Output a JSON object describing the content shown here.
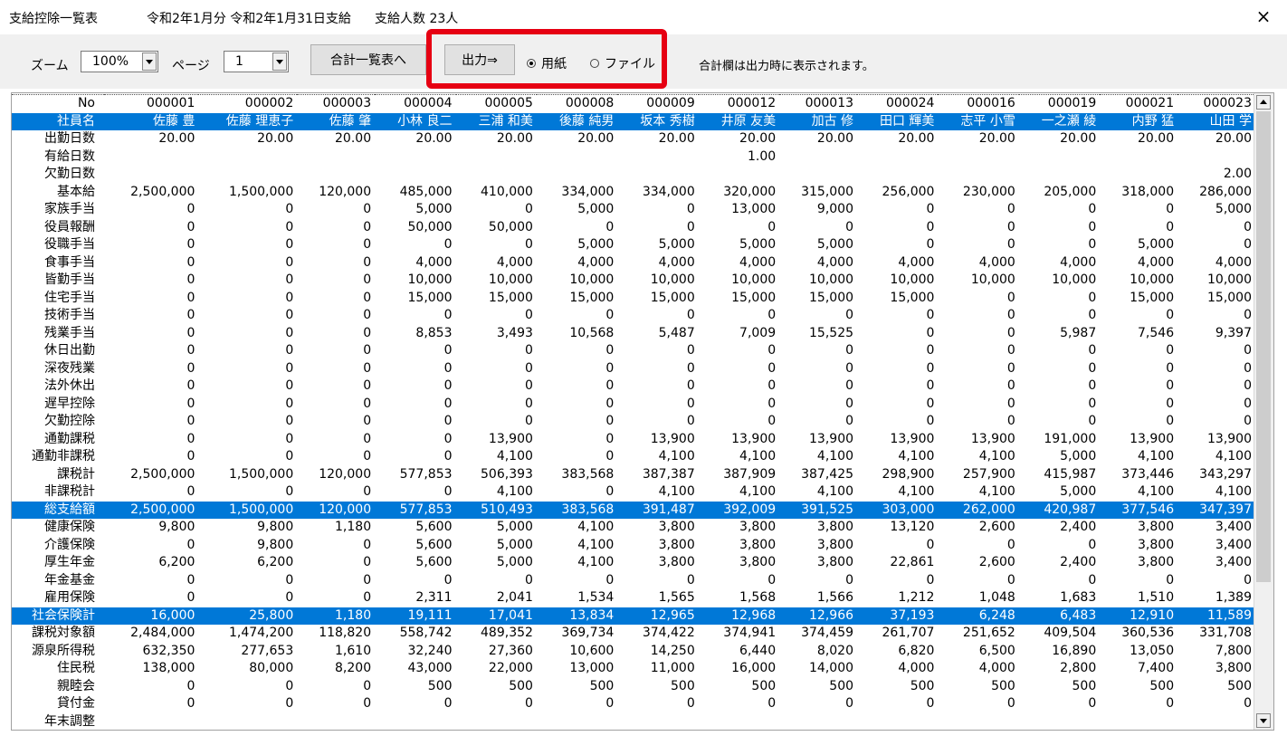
{
  "window": {
    "title": "支給控除一覧表",
    "period": "令和2年1月分 令和2年1月31日支給",
    "headcount": "支給人数 23人",
    "close_glyph": "×"
  },
  "toolbar": {
    "zoom_label": "ズーム",
    "zoom_value": "100%",
    "page_label": "ページ",
    "page_value": "1",
    "summary_button": "合計一覧表へ",
    "output_button": "出力⇒",
    "radio_paper": "用紙",
    "radio_file": "ファイル",
    "radio_selected": "paper",
    "note": "合計欄は出力時に表示されます。"
  },
  "colors": {
    "highlight": "#0078d7",
    "annotation": "#e60012"
  },
  "table": {
    "rows": [
      {
        "label": "No",
        "values": [
          "000001",
          "000002",
          "000003",
          "000004",
          "000005",
          "000008",
          "000009",
          "000012",
          "000013",
          "000024",
          "000016",
          "000019",
          "000021",
          "000023"
        ]
      },
      {
        "label": "社員名",
        "highlight": true,
        "values": [
          "佐藤 豊",
          "佐藤 理恵子",
          "佐藤 肇",
          "小林 良二",
          "三浦 和美",
          "後藤 純男",
          "坂本 秀樹",
          "井原 友美",
          "加古 修",
          "田口 輝美",
          "志平 小雪",
          "一之瀬 綾",
          "内野 猛",
          "山田 学"
        ]
      },
      {
        "label": "出勤日数",
        "values": [
          "20.00",
          "20.00",
          "20.00",
          "20.00",
          "20.00",
          "20.00",
          "20.00",
          "20.00",
          "20.00",
          "20.00",
          "20.00",
          "20.00",
          "20.00",
          "20.00"
        ]
      },
      {
        "label": "有給日数",
        "values": [
          "",
          "",
          "",
          "",
          "",
          "",
          "",
          "1.00",
          "",
          "",
          "",
          "",
          "",
          ""
        ]
      },
      {
        "label": "欠勤日数",
        "values": [
          "",
          "",
          "",
          "",
          "",
          "",
          "",
          "",
          "",
          "",
          "",
          "",
          "",
          "2.00"
        ]
      },
      {
        "label": "基本給",
        "values": [
          "2,500,000",
          "1,500,000",
          "120,000",
          "485,000",
          "410,000",
          "334,000",
          "334,000",
          "320,000",
          "315,000",
          "256,000",
          "230,000",
          "205,000",
          "318,000",
          "286,000"
        ]
      },
      {
        "label": "家族手当",
        "values": [
          "0",
          "0",
          "0",
          "5,000",
          "0",
          "5,000",
          "0",
          "13,000",
          "9,000",
          "0",
          "0",
          "0",
          "0",
          "5,000"
        ]
      },
      {
        "label": "役員報酬",
        "values": [
          "0",
          "0",
          "0",
          "50,000",
          "50,000",
          "0",
          "0",
          "0",
          "0",
          "0",
          "0",
          "0",
          "0",
          "0"
        ]
      },
      {
        "label": "役職手当",
        "values": [
          "0",
          "0",
          "0",
          "0",
          "0",
          "5,000",
          "5,000",
          "5,000",
          "5,000",
          "0",
          "0",
          "0",
          "5,000",
          "0"
        ]
      },
      {
        "label": "食事手当",
        "values": [
          "0",
          "0",
          "0",
          "4,000",
          "4,000",
          "4,000",
          "4,000",
          "4,000",
          "4,000",
          "4,000",
          "4,000",
          "4,000",
          "4,000",
          "4,000"
        ]
      },
      {
        "label": "皆勤手当",
        "values": [
          "0",
          "0",
          "0",
          "10,000",
          "10,000",
          "10,000",
          "10,000",
          "10,000",
          "10,000",
          "10,000",
          "10,000",
          "10,000",
          "10,000",
          "10,000"
        ]
      },
      {
        "label": "住宅手当",
        "values": [
          "0",
          "0",
          "0",
          "15,000",
          "15,000",
          "15,000",
          "15,000",
          "15,000",
          "15,000",
          "15,000",
          "0",
          "0",
          "15,000",
          "15,000"
        ]
      },
      {
        "label": "技術手当",
        "values": [
          "0",
          "0",
          "0",
          "0",
          "0",
          "0",
          "0",
          "0",
          "0",
          "0",
          "0",
          "0",
          "0",
          "0"
        ]
      },
      {
        "label": "残業手当",
        "values": [
          "0",
          "0",
          "0",
          "8,853",
          "3,493",
          "10,568",
          "5,487",
          "7,009",
          "15,525",
          "0",
          "0",
          "5,987",
          "7,546",
          "9,397"
        ]
      },
      {
        "label": "休日出勤",
        "values": [
          "0",
          "0",
          "0",
          "0",
          "0",
          "0",
          "0",
          "0",
          "0",
          "0",
          "0",
          "0",
          "0",
          "0"
        ]
      },
      {
        "label": "深夜残業",
        "values": [
          "0",
          "0",
          "0",
          "0",
          "0",
          "0",
          "0",
          "0",
          "0",
          "0",
          "0",
          "0",
          "0",
          "0"
        ]
      },
      {
        "label": "法外休出",
        "values": [
          "0",
          "0",
          "0",
          "0",
          "0",
          "0",
          "0",
          "0",
          "0",
          "0",
          "0",
          "0",
          "0",
          "0"
        ]
      },
      {
        "label": "遅早控除",
        "values": [
          "0",
          "0",
          "0",
          "0",
          "0",
          "0",
          "0",
          "0",
          "0",
          "0",
          "0",
          "0",
          "0",
          "0"
        ]
      },
      {
        "label": "欠勤控除",
        "values": [
          "0",
          "0",
          "0",
          "0",
          "0",
          "0",
          "0",
          "0",
          "0",
          "0",
          "0",
          "0",
          "0",
          "0"
        ]
      },
      {
        "label": "通勤課税",
        "values": [
          "0",
          "0",
          "0",
          "0",
          "13,900",
          "0",
          "13,900",
          "13,900",
          "13,900",
          "13,900",
          "13,900",
          "191,000",
          "13,900",
          "13,900"
        ]
      },
      {
        "label": "通勤非課税",
        "values": [
          "0",
          "0",
          "0",
          "0",
          "4,100",
          "0",
          "4,100",
          "4,100",
          "4,100",
          "4,100",
          "4,100",
          "5,000",
          "4,100",
          "4,100"
        ]
      },
      {
        "label": "課税計",
        "values": [
          "2,500,000",
          "1,500,000",
          "120,000",
          "577,853",
          "506,393",
          "383,568",
          "387,387",
          "387,909",
          "387,425",
          "298,900",
          "257,900",
          "415,987",
          "373,446",
          "343,297"
        ]
      },
      {
        "label": "非課税計",
        "values": [
          "0",
          "0",
          "0",
          "0",
          "4,100",
          "0",
          "4,100",
          "4,100",
          "4,100",
          "4,100",
          "4,100",
          "5,000",
          "4,100",
          "4,100"
        ]
      },
      {
        "label": "総支給額",
        "highlight": true,
        "values": [
          "2,500,000",
          "1,500,000",
          "120,000",
          "577,853",
          "510,493",
          "383,568",
          "391,487",
          "392,009",
          "391,525",
          "303,000",
          "262,000",
          "420,987",
          "377,546",
          "347,397"
        ]
      },
      {
        "label": "健康保険",
        "values": [
          "9,800",
          "9,800",
          "1,180",
          "5,600",
          "5,000",
          "4,100",
          "3,800",
          "3,800",
          "3,800",
          "13,120",
          "2,600",
          "2,400",
          "3,800",
          "3,400"
        ]
      },
      {
        "label": "介護保険",
        "values": [
          "0",
          "9,800",
          "0",
          "5,600",
          "5,000",
          "4,100",
          "3,800",
          "3,800",
          "3,800",
          "0",
          "0",
          "0",
          "3,800",
          "3,400"
        ]
      },
      {
        "label": "厚生年金",
        "values": [
          "6,200",
          "6,200",
          "0",
          "5,600",
          "5,000",
          "4,100",
          "3,800",
          "3,800",
          "3,800",
          "22,861",
          "2,600",
          "2,400",
          "3,800",
          "3,400"
        ]
      },
      {
        "label": "年金基金",
        "values": [
          "0",
          "0",
          "0",
          "0",
          "0",
          "0",
          "0",
          "0",
          "0",
          "0",
          "0",
          "0",
          "0",
          "0"
        ]
      },
      {
        "label": "雇用保険",
        "values": [
          "0",
          "0",
          "0",
          "2,311",
          "2,041",
          "1,534",
          "1,565",
          "1,568",
          "1,566",
          "1,212",
          "1,048",
          "1,683",
          "1,510",
          "1,389"
        ]
      },
      {
        "label": "社会保険計",
        "highlight": true,
        "values": [
          "16,000",
          "25,800",
          "1,180",
          "19,111",
          "17,041",
          "13,834",
          "12,965",
          "12,968",
          "12,966",
          "37,193",
          "6,248",
          "6,483",
          "12,910",
          "11,589"
        ]
      },
      {
        "label": "課税対象額",
        "values": [
          "2,484,000",
          "1,474,200",
          "118,820",
          "558,742",
          "489,352",
          "369,734",
          "374,422",
          "374,941",
          "374,459",
          "261,707",
          "251,652",
          "409,504",
          "360,536",
          "331,708"
        ]
      },
      {
        "label": "源泉所得税",
        "values": [
          "632,350",
          "277,653",
          "1,610",
          "32,240",
          "27,360",
          "10,600",
          "14,250",
          "6,440",
          "8,020",
          "6,820",
          "6,500",
          "16,890",
          "13,050",
          "7,800"
        ]
      },
      {
        "label": "住民税",
        "values": [
          "138,000",
          "80,000",
          "8,200",
          "43,000",
          "22,000",
          "13,000",
          "11,000",
          "16,000",
          "14,000",
          "4,000",
          "4,000",
          "2,800",
          "7,400",
          "3,800"
        ]
      },
      {
        "label": "親睦会",
        "values": [
          "0",
          "0",
          "0",
          "500",
          "500",
          "500",
          "500",
          "500",
          "500",
          "500",
          "500",
          "500",
          "500",
          "500"
        ]
      },
      {
        "label": "貸付金",
        "values": [
          "0",
          "0",
          "0",
          "0",
          "0",
          "0",
          "0",
          "0",
          "0",
          "0",
          "0",
          "0",
          "0",
          "0"
        ]
      },
      {
        "label": "年末調整",
        "values": [
          "",
          "",
          "",
          "",
          "",
          "",
          "",
          "",
          "",
          "",
          "",
          "",
          "",
          ""
        ]
      }
    ]
  }
}
